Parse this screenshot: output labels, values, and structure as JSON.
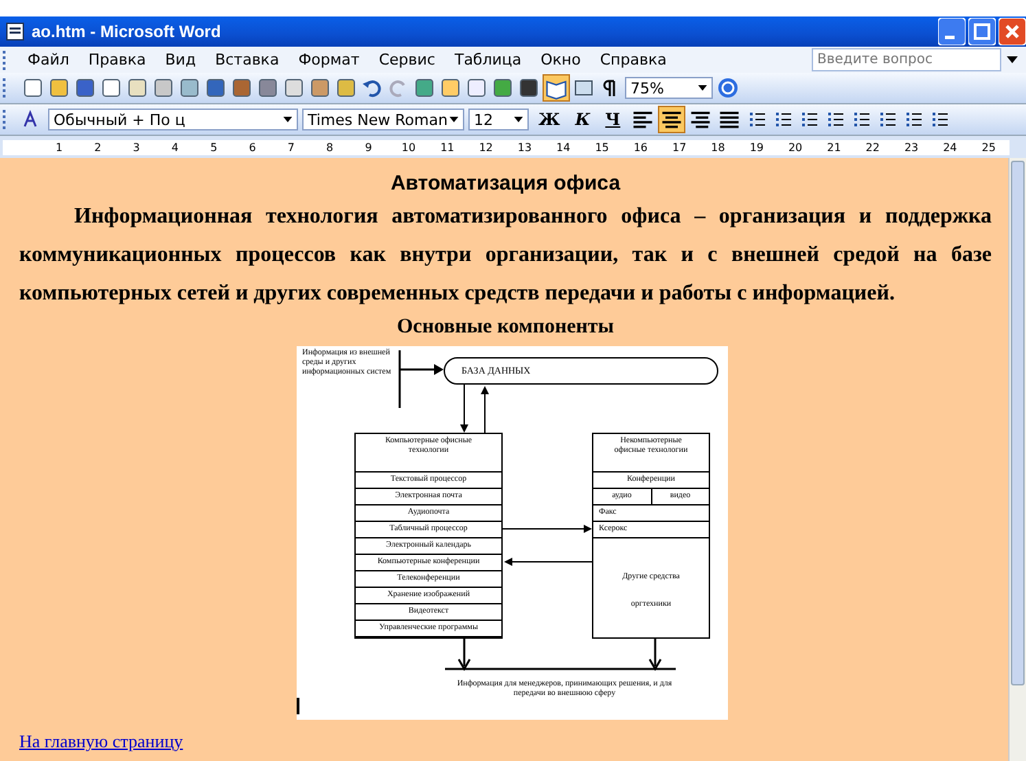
{
  "window": {
    "title": "ao.htm - Microsoft Word"
  },
  "menu": [
    "Файл",
    "Правка",
    "Вид",
    "Вставка",
    "Формат",
    "Сервис",
    "Таблица",
    "Окно",
    "Справка"
  ],
  "help_search": {
    "placeholder": "Введите вопрос"
  },
  "toolbar": {
    "reading_button_on": true,
    "zoom": "75%"
  },
  "format_bar": {
    "style": "Обычный + По ц",
    "font": "Times New Roman",
    "size": "12",
    "bold": "Ж",
    "italic": "К",
    "underline": "Ч",
    "alignment": [
      {
        "selected": false
      },
      {
        "selected": true
      },
      {
        "selected": false
      },
      {
        "selected": false
      }
    ]
  },
  "ruler": [
    "1",
    "2",
    "3",
    "4",
    "5",
    "6",
    "7",
    "8",
    "9",
    "10",
    "11",
    "12",
    "13",
    "14",
    "15",
    "16",
    "17",
    "18",
    "19",
    "20",
    "21",
    "22",
    "23",
    "24",
    "25"
  ],
  "document": {
    "heading": "Автоматизация офиса",
    "paragraph": "Информационная технология автоматизированного офиса – организация и поддержка коммуникационных процессов как внутри организации, так и с внешней средой на базе компьютерных сетей и других современных средств передачи и работы с информацией.",
    "subheading": "Основные компоненты",
    "diagram": {
      "source": "Информация из внешней среды и других информационных систем",
      "database": "БАЗА ДАННЫХ",
      "left_header": "Компьютерные офисные технологии",
      "left_items": [
        "Текстовый процессор",
        "Электронная почта",
        "Аудиопочта",
        "Табличный процессор",
        "Электронный календарь",
        "Компьютерные конференции",
        "Телеконференции",
        "Хранение изображений",
        "Видеотекст",
        "Управленческие программы"
      ],
      "right_header": "Некомпьютерные офисные технологии",
      "conferences": "Конференции",
      "audio": "аудио",
      "video": "видео",
      "fax": "Факс",
      "copier": "Ксерокс",
      "other": "Другие средства оргтехники",
      "output": "Информация для менеджеров, принимающих решения, и для передачи во внешнюю сферу"
    },
    "link": "На главную страницу"
  }
}
